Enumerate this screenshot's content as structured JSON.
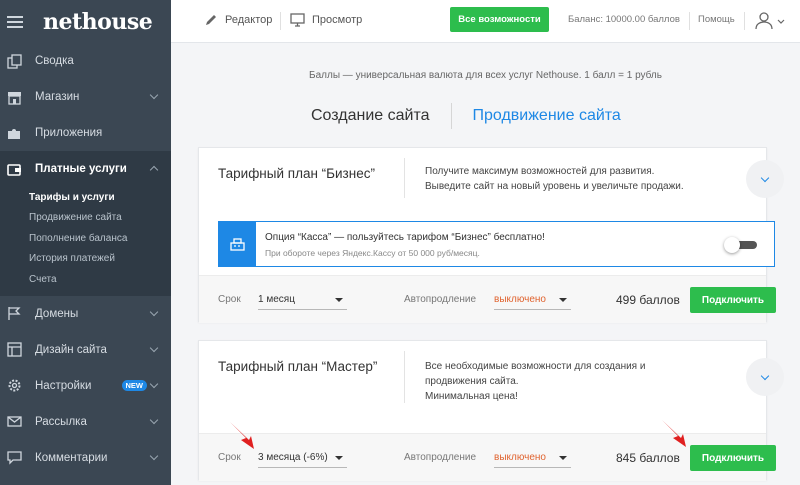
{
  "brand": {
    "logo": "nethouse"
  },
  "sidebar": {
    "items": [
      {
        "label": "Сводка",
        "icon": "copy-icon"
      },
      {
        "label": "Магазин",
        "icon": "shop-icon"
      },
      {
        "label": "Приложения",
        "icon": "puzzle-icon"
      },
      {
        "label": "Платные услуги",
        "icon": "wallet-icon"
      },
      {
        "label": "Домены",
        "icon": "flag-icon"
      },
      {
        "label": "Дизайн сайта",
        "icon": "layout-icon"
      },
      {
        "label": "Настройки",
        "icon": "gear-icon",
        "badge": "NEW"
      },
      {
        "label": "Рассылка",
        "icon": "mail-icon"
      },
      {
        "label": "Комментарии",
        "icon": "comment-icon"
      }
    ],
    "subitems": [
      "Тарифы и услуги",
      "Продвижение сайта",
      "Пополнение баланса",
      "История платежей",
      "Счета"
    ]
  },
  "topbar": {
    "editor": "Редактор",
    "preview": "Просмотр",
    "all_features": "Все возможности",
    "balance": "Баланс: 10000.00 баллов",
    "help": "Помощь"
  },
  "main": {
    "info": "Баллы — универсальная валюта для всех услуг Nethouse. 1 балл = 1 рубль",
    "tabs": [
      "Создание сайта",
      "Продвижение сайта"
    ],
    "plans": [
      {
        "title": "Тарифный план “Бизнес”",
        "desc": [
          "Получите максимум возможностей для развития.",
          "Выведите сайт на новый уровень и увеличьте продажи."
        ],
        "promo": {
          "title": "Опция “Касса” — пользуйтесь тарифом “Бизнес” бесплатно!",
          "subtitle": "При обороте через Яндекс.Кассу от 50 000 руб/месяц."
        },
        "term_label": "Срок",
        "term_value": "1 месяц",
        "autorenew_label": "Автопродление",
        "autorenew_value": "выключено",
        "price": "499 баллов",
        "button": "Подключить"
      },
      {
        "title": "Тарифный план “Мастер”",
        "desc": [
          "Все необходимые возможности для создания и",
          "продвижения сайта.",
          "Минимальная цена!"
        ],
        "term_label": "Срок",
        "term_value": "3 месяца (-6%)",
        "autorenew_label": "Автопродление",
        "autorenew_value": "выключено",
        "price": "845 баллов",
        "button": "Подключить"
      }
    ]
  },
  "colors": {
    "accent": "#1e88e5",
    "green": "#2dbd4d",
    "sidebar": "#3b4753",
    "arrow": "#e02020",
    "off": "#e0632f"
  }
}
